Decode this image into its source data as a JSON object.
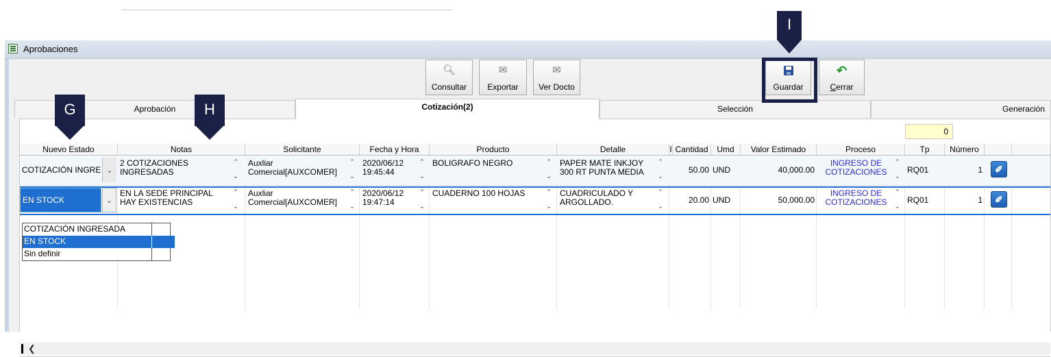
{
  "window": {
    "title": "Aprobaciones"
  },
  "toolbar": {
    "consultar": "Consultar",
    "exportar": "Exportar",
    "ver_docto": "Ver Docto",
    "guardar": "Guardar",
    "cerrar_underlined": "C",
    "cerrar_rest": "errar"
  },
  "callouts": {
    "g": "G",
    "h": "H",
    "i": "I"
  },
  "tabs": [
    "Aprobación",
    "Cotización(2)",
    "Selección",
    "Generación"
  ],
  "count": "0",
  "columns": [
    "Nuevo Estado",
    "Notas",
    "Solicitante",
    "Fecha y Hora",
    "Producto",
    "Detalle",
    "I",
    "Cantidad",
    "Umd",
    "Valor Estimado",
    "Proceso",
    "Tp",
    "Número"
  ],
  "rows": [
    {
      "estado": "COTIZACIÓN INGRESADA",
      "notas": "2 COTIZACIONES INGRESADAS",
      "solicitante": "Auxliar Comercial[AUXCOMER]",
      "fecha": "2020/06/12 19:45:44",
      "producto": "BOLIGRAFO NEGRO",
      "detalle": "PAPER MATE INKJOY 300 RT PUNTA MEDIA",
      "cantidad": "50.00",
      "umd": "UND",
      "valor": "40,000.00",
      "proceso": "INGRESO DE COTIZACIONES",
      "tp": "RQ01",
      "numero": "1"
    },
    {
      "estado": "EN STOCK",
      "notas": "EN LA SEDE PRINCIPAL HAY EXISTENCIAS",
      "solicitante": "Auxliar Comercial[AUXCOMER]",
      "fecha": "2020/06/12 19:47:14",
      "producto": "CUADERNO 100 HOJAS",
      "detalle": "CUADRICULADO Y ARGOLLADO.",
      "cantidad": "20.00",
      "umd": "UND",
      "valor": "50,000.00",
      "proceso": "INGRESO DE COTIZACIONES",
      "tp": "RQ01",
      "numero": "1"
    }
  ],
  "dropdown_options": [
    "COTIZACIÓN INGRESADA",
    "EN STOCK",
    "Sin definir"
  ],
  "icons": {
    "window": "form-icon",
    "consultar": "magnifier-icon",
    "exportar": "export-icon",
    "ver_docto": "document-icon",
    "guardar": "floppy-disk-icon",
    "cerrar": "undo-arrow-icon",
    "attachment": "paperclip-icon"
  },
  "colors": {
    "callout": "#1a2046",
    "selection": "#1f6fd1",
    "proceso_text": "#2a2ad8",
    "count_bg": "#ffffcc"
  }
}
